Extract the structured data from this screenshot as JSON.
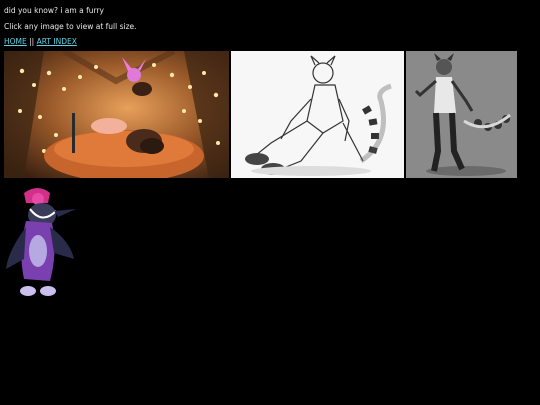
{
  "intro": "did you know? i am a furry",
  "instructions": "Click any image to view at full size.",
  "nav": {
    "home": "HOME",
    "separator": "||",
    "art_index": "ART INDEX"
  },
  "colors": {
    "background": "#000000",
    "text": "#e8e8e8",
    "link": "#5fd3e6"
  }
}
